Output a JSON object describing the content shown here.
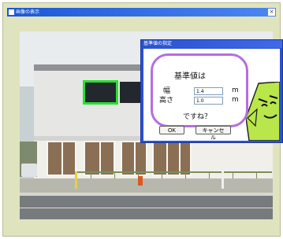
{
  "main_window": {
    "title": "画像の表示"
  },
  "dialog": {
    "title": "基準値の指定",
    "prompt": "基準値は",
    "width_label": "幅",
    "width_value": "1.4",
    "width_unit": "m",
    "height_label": "高さ",
    "height_value": "1.0",
    "height_unit": "m",
    "confirm_text": "ですね？",
    "ok_label": "OK",
    "cancel_label": "キャンセル"
  },
  "colors": {
    "selection": "#28e030",
    "dialog_frame": "#2b52d4",
    "bubble_border": "#b66de0",
    "character": "#b9e64a"
  }
}
